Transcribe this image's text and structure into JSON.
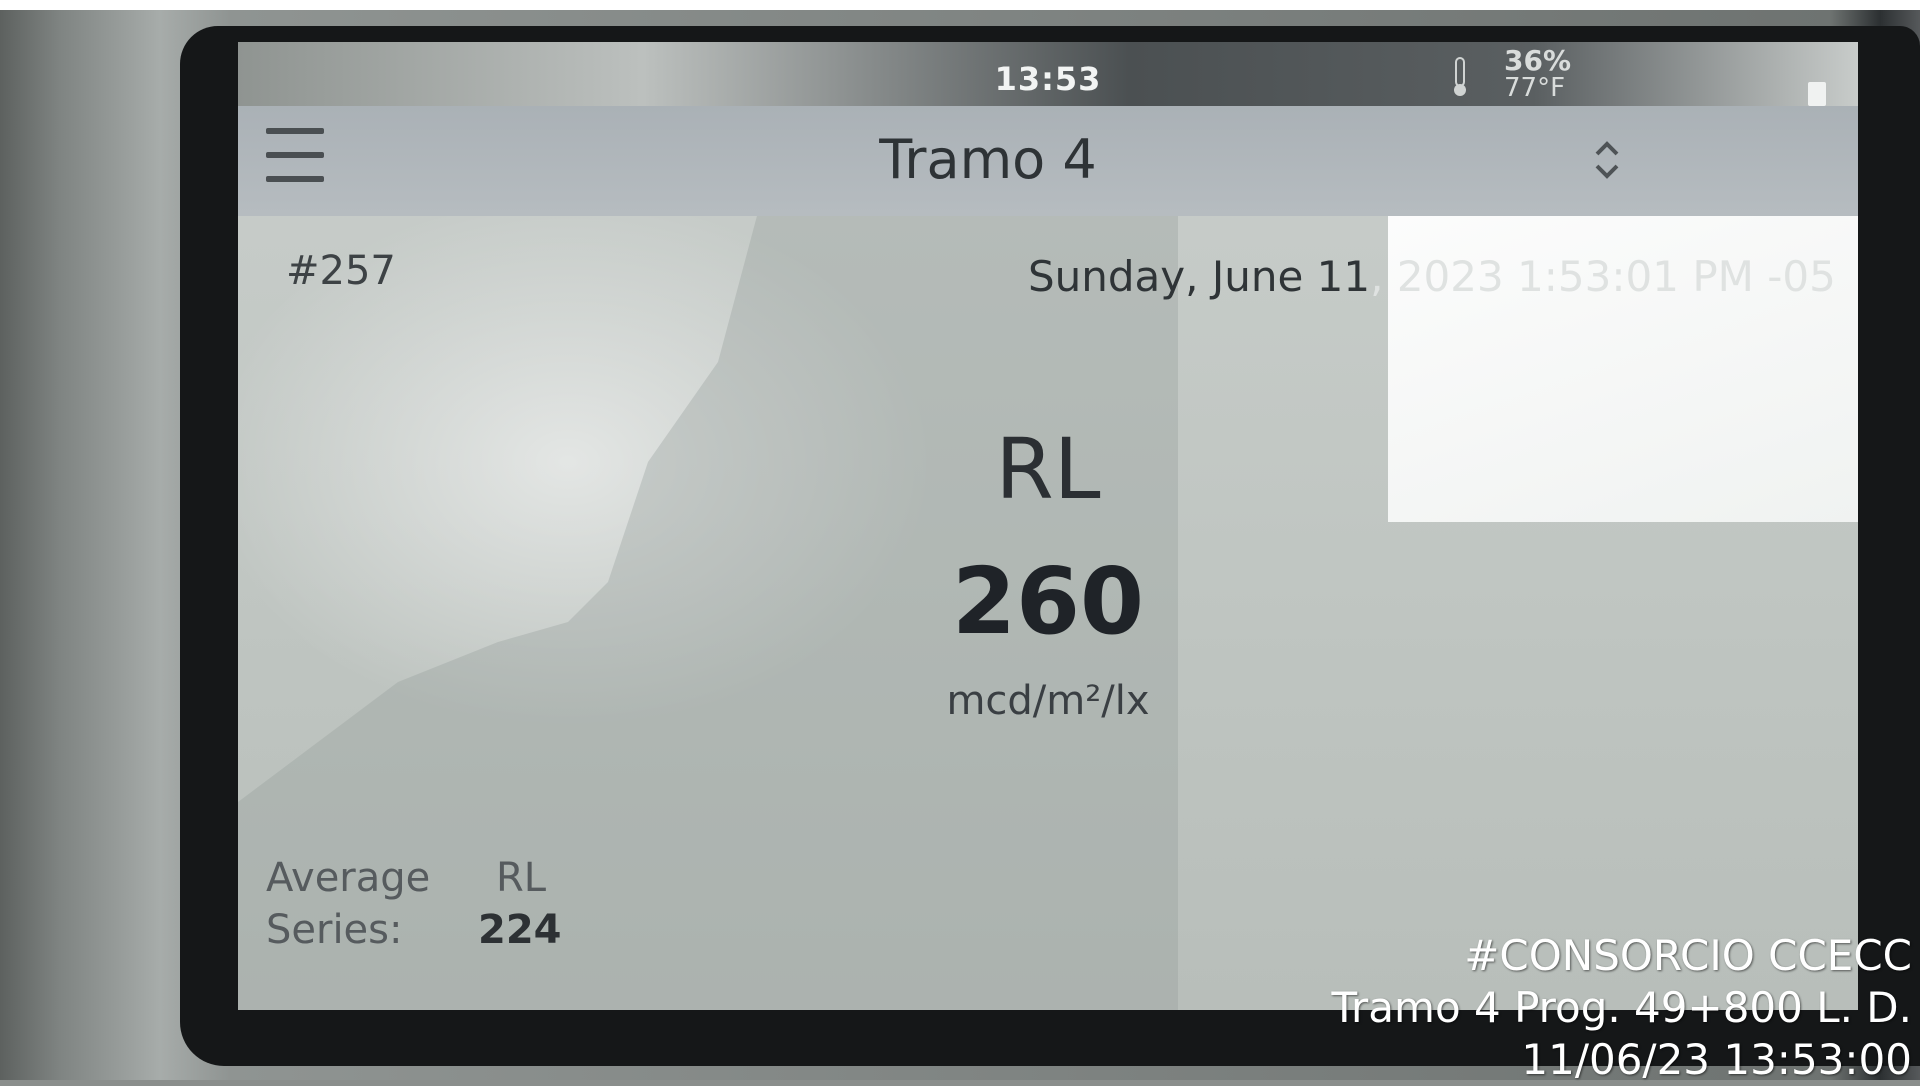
{
  "device": {
    "status_bar": {
      "time": "13:53",
      "humidity": "36%",
      "temperature": "77°F"
    },
    "header": {
      "title": "Tramo 4",
      "menu_icon": "hamburger-menu-icon",
      "sort_icon": "sort-up-down-icon"
    },
    "record": {
      "id": "#257",
      "datetime_visible": "Sunday, June 11",
      "datetime_faded": ", 2023 1:53:01 PM -05"
    },
    "measurement": {
      "label": "RL",
      "value": "260",
      "unit": "mcd/m²/lx"
    },
    "average": {
      "label_line1": "Average",
      "label_line2": "Series:",
      "metric": "RL",
      "value": "224"
    }
  },
  "watermark": {
    "line1": "#CONSORCIO CCECC",
    "line2": "Tramo 4 Prog. 49+800 L. D.",
    "line3": "11/06/23  13:53:00"
  },
  "colors": {
    "screen_bg": "#c4c9c6",
    "header_bg": "#b2b8bc",
    "text_dark": "#1f2328",
    "bezel": "#151718",
    "watermark_text": "#ffffff"
  }
}
